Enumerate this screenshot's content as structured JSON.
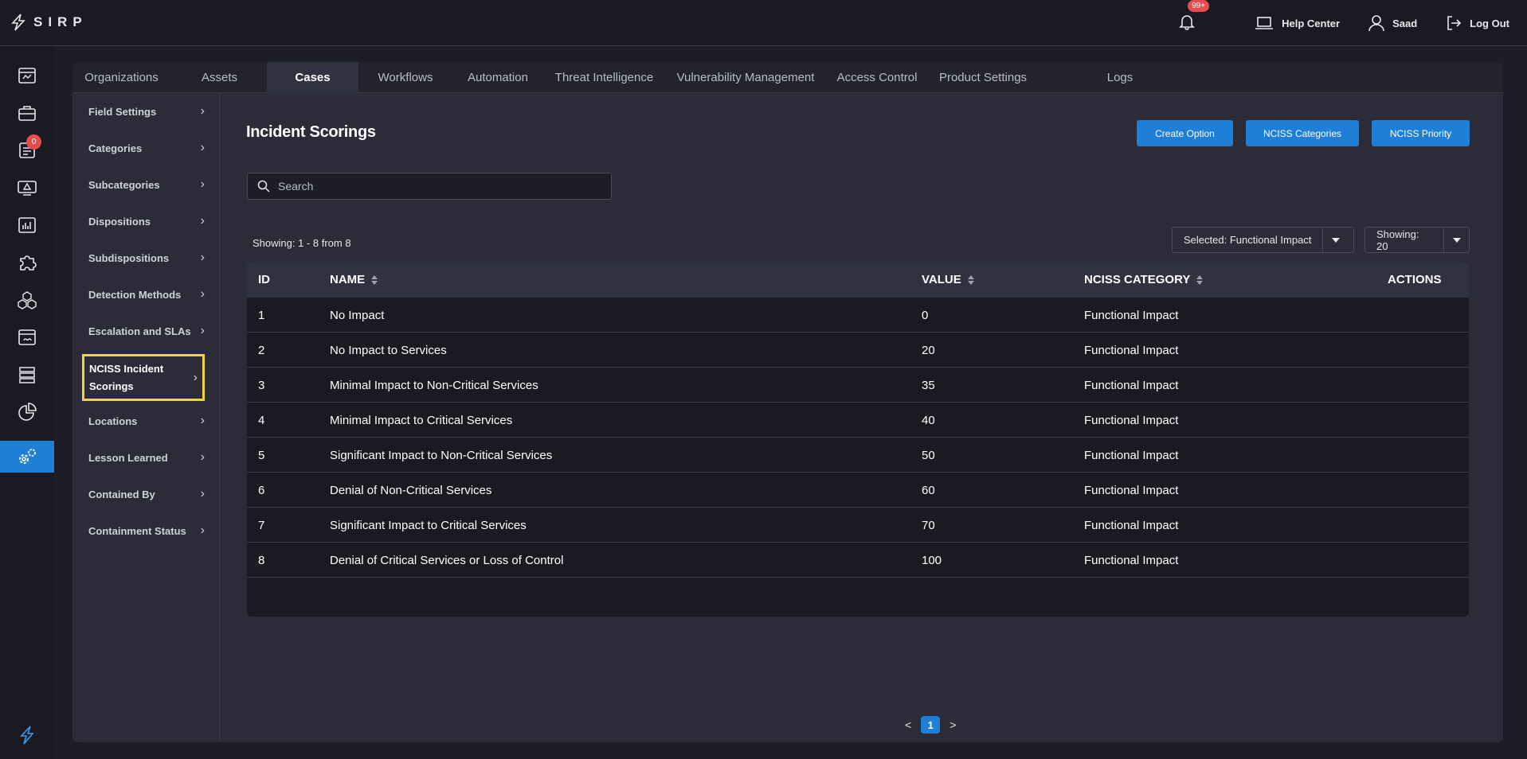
{
  "app": {
    "logo_text": "SIRP"
  },
  "topbar": {
    "notifications_badge": "99+",
    "help_center": "Help Center",
    "user_name": "Saad",
    "logout": "Log Out"
  },
  "iconrail": {
    "items": [
      {
        "icon": "dashboard-icon"
      },
      {
        "icon": "briefcase-icon"
      },
      {
        "icon": "cases-list-icon",
        "badge": "0"
      },
      {
        "icon": "monitor-alert-icon"
      },
      {
        "icon": "analytics-icon"
      },
      {
        "icon": "puzzle-icon"
      },
      {
        "icon": "cubes-icon"
      },
      {
        "icon": "assets-board-icon"
      },
      {
        "icon": "database-icon"
      },
      {
        "icon": "pie-chart-icon"
      },
      {
        "icon": "settings-gears-icon",
        "active": true
      }
    ]
  },
  "tabs": [
    {
      "label": "Organizations"
    },
    {
      "label": "Assets"
    },
    {
      "label": "Cases",
      "active": true
    },
    {
      "label": "Workflows"
    },
    {
      "label": "Automation"
    },
    {
      "label": "Threat Intelligence"
    },
    {
      "label": "Vulnerability Management"
    },
    {
      "label": "Access Control"
    },
    {
      "label": "Product Settings"
    },
    {
      "label": "Logs"
    }
  ],
  "subnav": {
    "items": [
      {
        "label": "Field Settings"
      },
      {
        "label": "Categories"
      },
      {
        "label": "Subcategories"
      },
      {
        "label": "Dispositions"
      },
      {
        "label": "Subdispositions"
      },
      {
        "label": "Detection Methods"
      },
      {
        "label": "Escalation and SLAs"
      },
      {
        "label": "NCISS Incident Scorings",
        "active": true
      },
      {
        "label": "Locations"
      },
      {
        "label": "Lesson Learned"
      },
      {
        "label": "Contained By"
      },
      {
        "label": "Containment Status"
      }
    ]
  },
  "main": {
    "title": "Incident Scorings",
    "buttons": {
      "create": "Create Option",
      "categories": "NCISS Categories",
      "priority": "NCISS Priority"
    },
    "search": {
      "placeholder": "Search",
      "value": ""
    },
    "showing_text": "Showing: 1 - 8 from 8",
    "filter_selected": "Selected: Functional Impact",
    "page_size": "Showing: 20"
  },
  "table": {
    "columns": [
      "ID",
      "NAME",
      "VALUE",
      "NCISS CATEGORY",
      "ACTIONS"
    ],
    "rows": [
      {
        "id": "1",
        "name": "No Impact",
        "value": "0",
        "category": "Functional Impact"
      },
      {
        "id": "2",
        "name": "No Impact to Services",
        "value": "20",
        "category": "Functional Impact"
      },
      {
        "id": "3",
        "name": "Minimal Impact to Non-Critical Services",
        "value": "35",
        "category": "Functional Impact"
      },
      {
        "id": "4",
        "name": "Minimal Impact to Critical Services",
        "value": "40",
        "category": "Functional Impact"
      },
      {
        "id": "5",
        "name": "Significant Impact to Non-Critical Services",
        "value": "50",
        "category": "Functional Impact"
      },
      {
        "id": "6",
        "name": "Denial of Non-Critical Services",
        "value": "60",
        "category": "Functional Impact"
      },
      {
        "id": "7",
        "name": "Significant Impact to Critical Services",
        "value": "70",
        "category": "Functional Impact"
      },
      {
        "id": "8",
        "name": "Denial of Critical Services or Loss of Control",
        "value": "100",
        "category": "Functional Impact"
      }
    ]
  },
  "pagination": {
    "current": "1",
    "prev": "<",
    "next": ">"
  },
  "colors": {
    "accent": "#1f7fd6",
    "highlight": "#f2d23c",
    "badge": "#e74c4c"
  }
}
